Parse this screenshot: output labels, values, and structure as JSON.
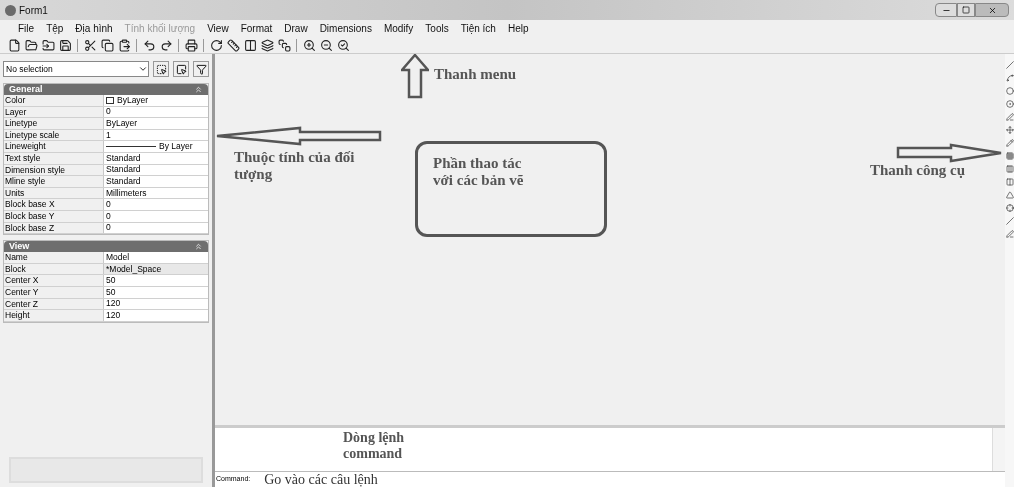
{
  "window": {
    "title": "Form1"
  },
  "menu": [
    {
      "label": "File",
      "disabled": false
    },
    {
      "label": "Tệp",
      "disabled": false
    },
    {
      "label": "Địa hình",
      "disabled": false
    },
    {
      "label": "Tính khối lượng",
      "disabled": true
    },
    {
      "label": "View",
      "disabled": false
    },
    {
      "label": "Format",
      "disabled": false
    },
    {
      "label": "Draw",
      "disabled": false
    },
    {
      "label": "Dimensions",
      "disabled": false
    },
    {
      "label": "Modify",
      "disabled": false
    },
    {
      "label": "Tools",
      "disabled": false
    },
    {
      "label": "Tiện ích",
      "disabled": false
    },
    {
      "label": "Help",
      "disabled": false
    }
  ],
  "properties": {
    "selection": "No selection",
    "sections": [
      {
        "title": "General",
        "expanded": true,
        "rows": [
          {
            "name": "Color",
            "value": "ByLayer",
            "kind": "color"
          },
          {
            "name": "Layer",
            "value": "0",
            "kind": "text"
          },
          {
            "name": "Linetype",
            "value": "ByLayer",
            "kind": "text"
          },
          {
            "name": "Linetype scale",
            "value": "1",
            "kind": "text"
          },
          {
            "name": "Lineweight",
            "value": "By Layer",
            "kind": "lineweight"
          },
          {
            "name": "Text style",
            "value": "Standard",
            "kind": "text"
          },
          {
            "name": "Dimension style",
            "value": "Standard",
            "kind": "text"
          },
          {
            "name": "Mline style",
            "value": "Standard",
            "kind": "text"
          },
          {
            "name": "Units",
            "value": "Millimeters",
            "kind": "text"
          },
          {
            "name": "Block base X",
            "value": "0",
            "kind": "text"
          },
          {
            "name": "Block base Y",
            "value": "0",
            "kind": "text"
          },
          {
            "name": "Block base Z",
            "value": "0",
            "kind": "text"
          }
        ]
      },
      {
        "title": "View",
        "expanded": true,
        "rows": [
          {
            "name": "Name",
            "value": "Model",
            "kind": "text"
          },
          {
            "name": "Block",
            "value": "*Model_Space",
            "kind": "readonly"
          },
          {
            "name": "Center X",
            "value": "50",
            "kind": "text"
          },
          {
            "name": "Center Y",
            "value": "50",
            "kind": "text"
          },
          {
            "name": "Center Z",
            "value": "120",
            "kind": "text"
          },
          {
            "name": "Height",
            "value": "120",
            "kind": "text"
          }
        ]
      }
    ]
  },
  "annotations": {
    "menu_label": "Thanh menu",
    "properties_label": "Thuộc tính của đối tượng",
    "drawing_area_label": "Phần thao tác với các bản vẽ",
    "toolbar_label": "Thanh công cụ",
    "command_label": "Dòng lệnh command"
  },
  "command": {
    "prompt": "Command:",
    "value": "Go vào các câu lệnh"
  }
}
